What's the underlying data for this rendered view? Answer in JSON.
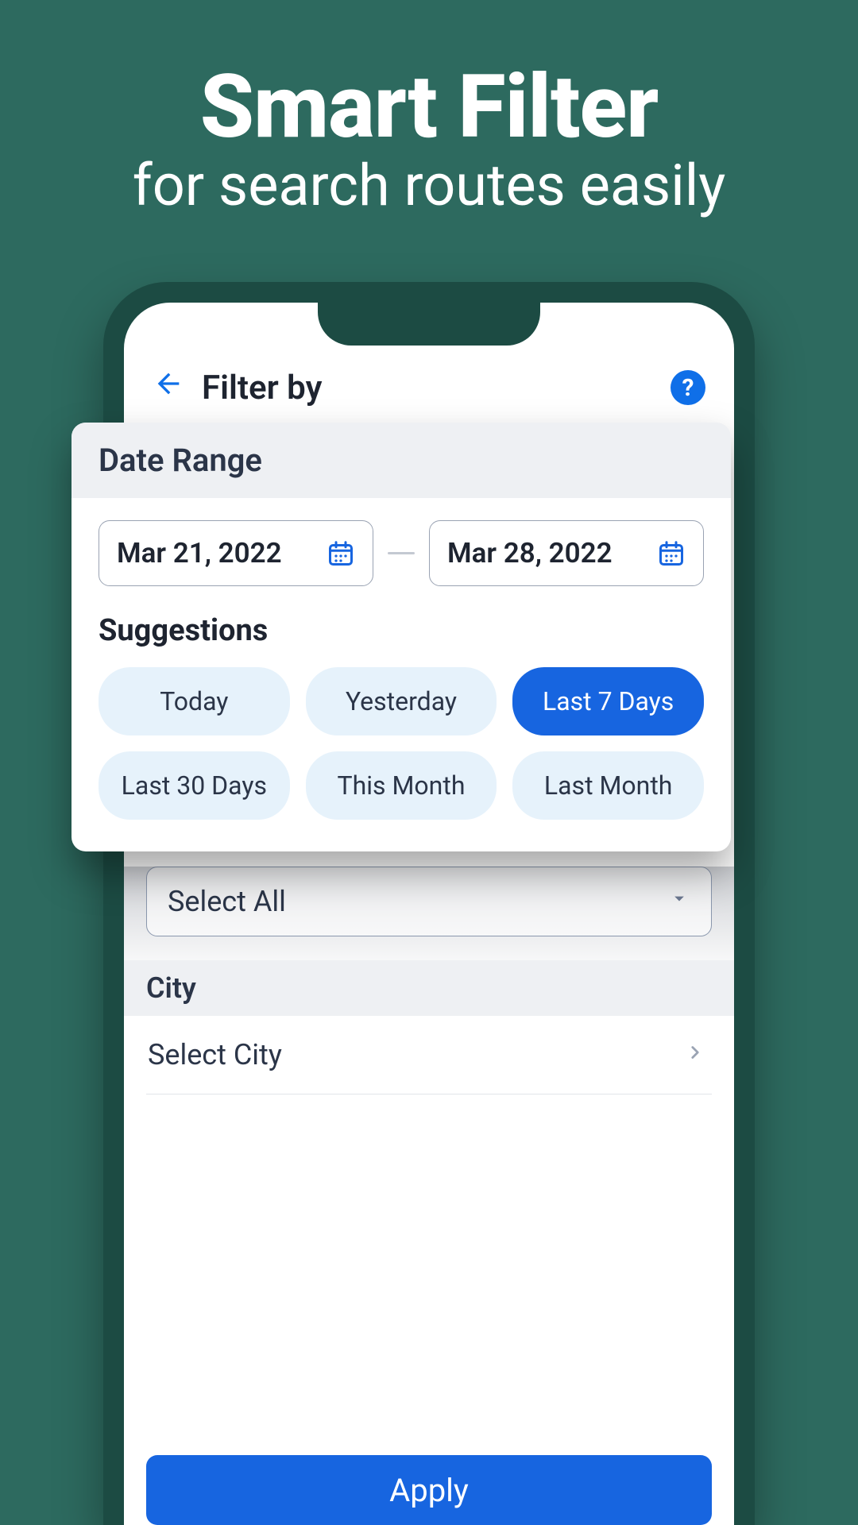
{
  "promo": {
    "title": "Smart Filter",
    "subtitle": "for search routes easily"
  },
  "appbar": {
    "title": "Filter by",
    "help": "?"
  },
  "popup": {
    "header": "Date Range",
    "start_date": "Mar 21, 2022",
    "end_date": "Mar 28, 2022",
    "suggestions_label": "Suggestions",
    "chips": [
      "Today",
      "Yesterday",
      "Last 7 Days",
      "Last 30 Days",
      "This Month",
      "Last Month"
    ],
    "selected_index": 2
  },
  "behind": {
    "select_all": "Select All",
    "city_label": "City",
    "select_city": "Select City"
  },
  "apply_label": "Apply"
}
